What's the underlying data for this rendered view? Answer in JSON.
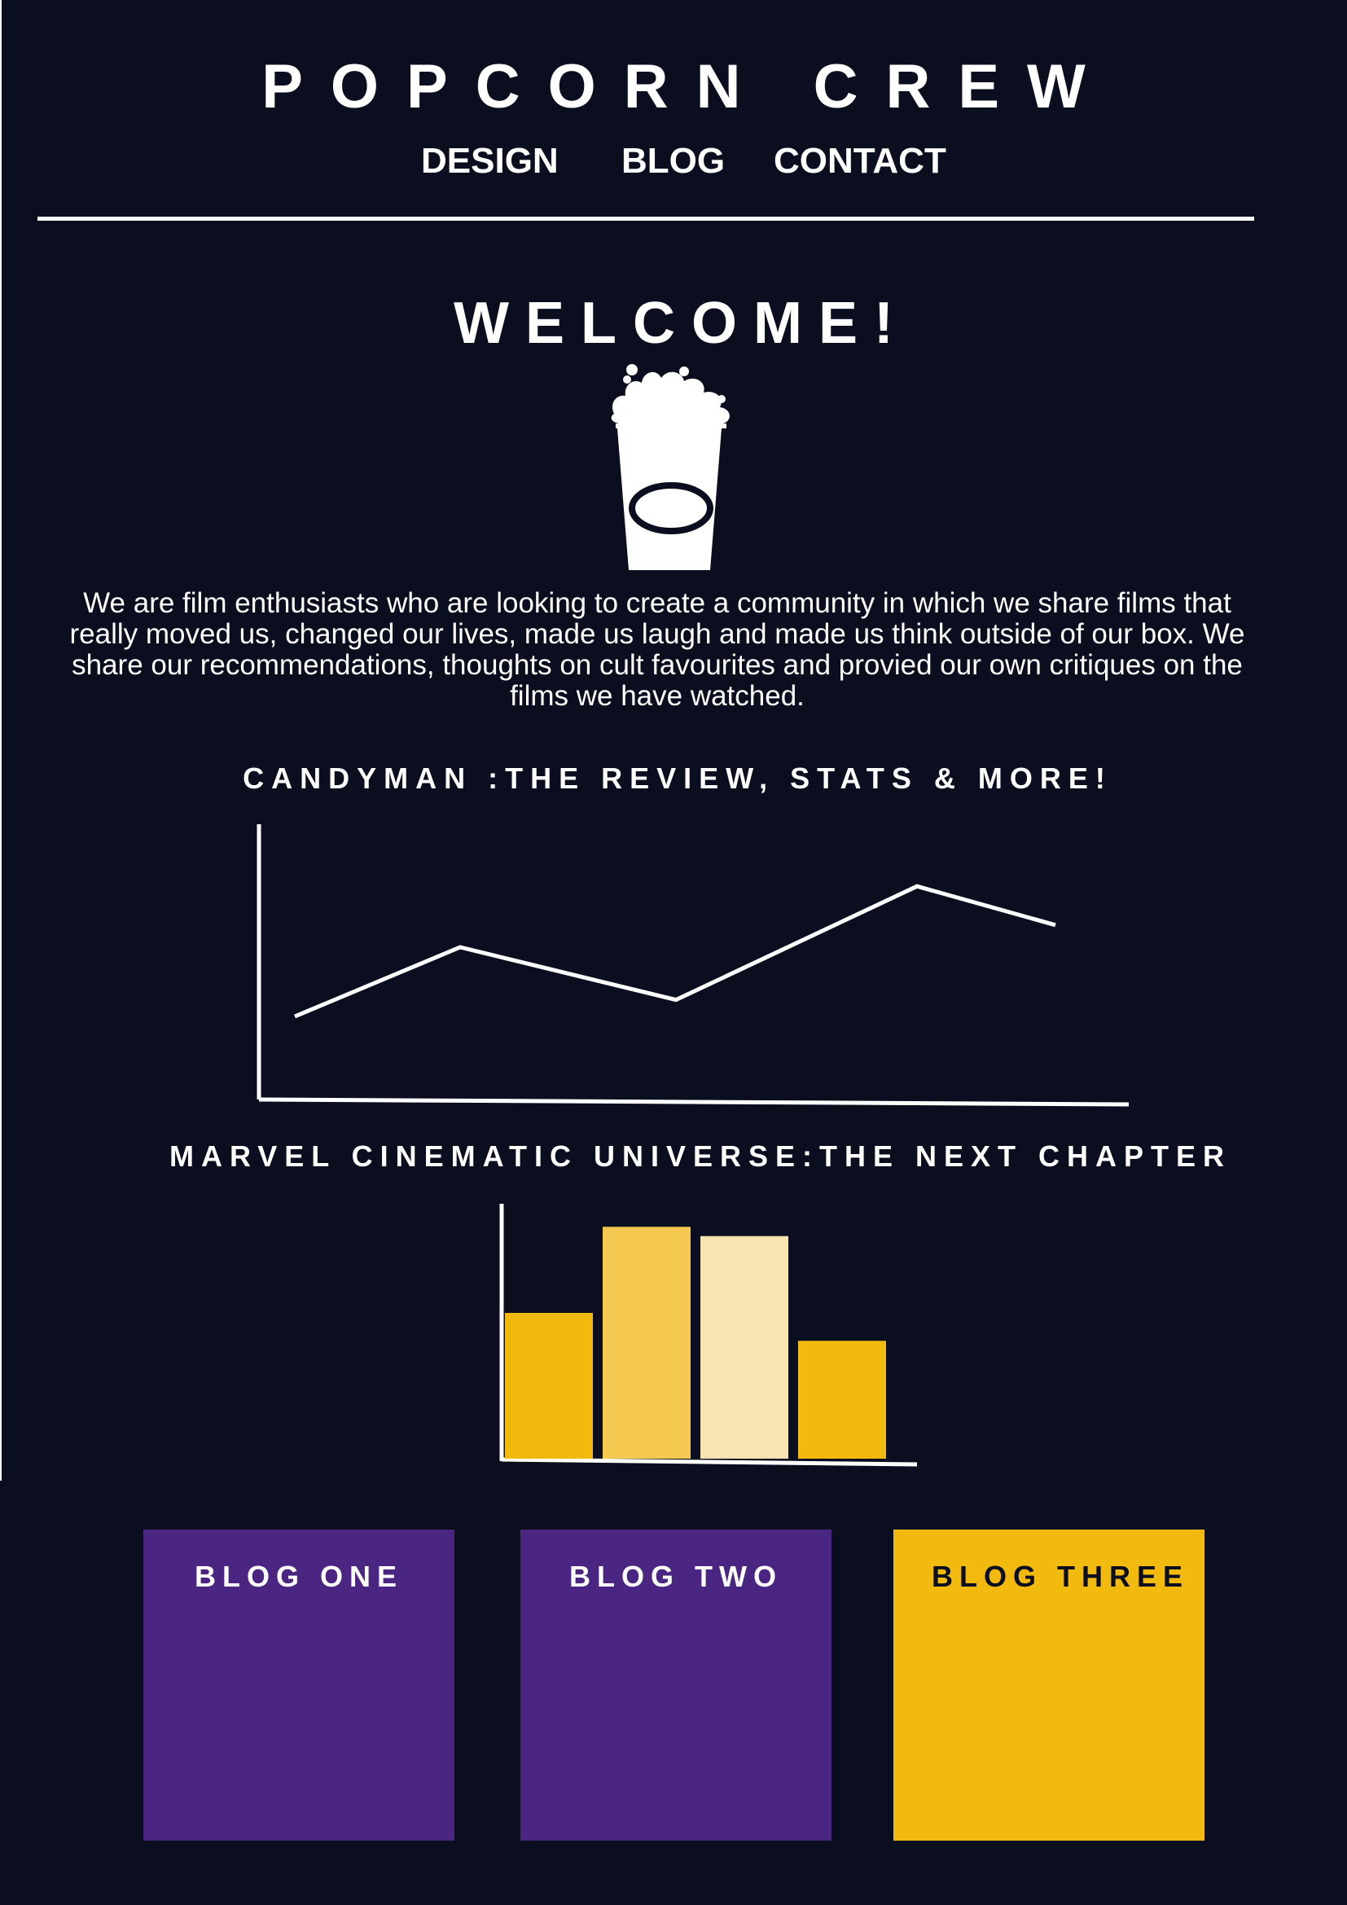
{
  "site": {
    "title": "POPCORN CREW"
  },
  "nav": {
    "items": [
      {
        "label": "DESIGN"
      },
      {
        "label": "BLOG"
      },
      {
        "label": "CONTACT"
      }
    ]
  },
  "hero": {
    "heading": "WELCOME!",
    "icon": "popcorn-cup-icon",
    "intro": "We are film enthusiasts who are looking to create a community in which we share films that really moved us, changed our lives, made us laugh and made us think outside of our box. We share our recommendations, thoughts on cult favourites and provied our own critiques on the films we have watched."
  },
  "colors": {
    "background": "#0b0e1f",
    "text": "#ffffff",
    "purple": "#4a2682",
    "yellow": "#f2b90f",
    "yellow_mid": "#f5c850",
    "yellow_light": "#f9e3b1"
  },
  "chart_data": [
    {
      "type": "line",
      "title": "CANDYMAN :THE REVIEW, STATS &  MORE!",
      "xlabel": "",
      "ylabel": "",
      "x": [
        1,
        2,
        3,
        4,
        5
      ],
      "series": [
        {
          "values": [
            30,
            55,
            36,
            77,
            63
          ]
        }
      ],
      "ylim": [
        0,
        100
      ],
      "grid": false,
      "legend": "none"
    },
    {
      "type": "bar",
      "title": "MARVEL CINEMATIC UNIVERSE:THE NEXT CHAPTER",
      "xlabel": "",
      "ylabel": "",
      "categories": [
        "1",
        "2",
        "3",
        "4"
      ],
      "values": [
        63,
        100,
        96,
        51
      ],
      "ylim": [
        0,
        105
      ],
      "bar_colors": [
        "#f2b90f",
        "#f5c850",
        "#f9e3b1",
        "#f2b90f"
      ],
      "grid": false,
      "legend": "none"
    }
  ],
  "blogs": [
    {
      "label": "BLOG ONE",
      "color": "#4a2682",
      "text_color": "#ffffff"
    },
    {
      "label": "BLOG TWO",
      "color": "#4a2682",
      "text_color": "#ffffff"
    },
    {
      "label": "BLOG THREE",
      "color": "#f2b90f",
      "text_color": "#0b0e1f"
    }
  ]
}
